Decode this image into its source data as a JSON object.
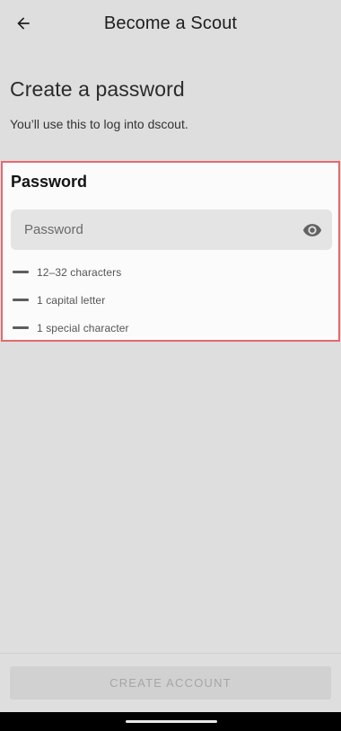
{
  "app_bar": {
    "title": "Become a Scout",
    "back_icon": "arrow-left-icon"
  },
  "page": {
    "heading": "Create a password",
    "subheading": "You’ll use this to log into dscout."
  },
  "password_card": {
    "label": "Password",
    "field": {
      "placeholder": "Password",
      "value": "",
      "toggle_icon": "eye-icon"
    },
    "rules": [
      {
        "icon": "dash-icon",
        "text": "12–32 characters"
      },
      {
        "icon": "dash-icon",
        "text": "1 capital letter"
      },
      {
        "icon": "dash-icon",
        "text": "1 special character"
      }
    ],
    "highlight_color": "#e36a6f"
  },
  "footer": {
    "create_label": "CREATE ACCOUNT",
    "create_enabled": false
  }
}
